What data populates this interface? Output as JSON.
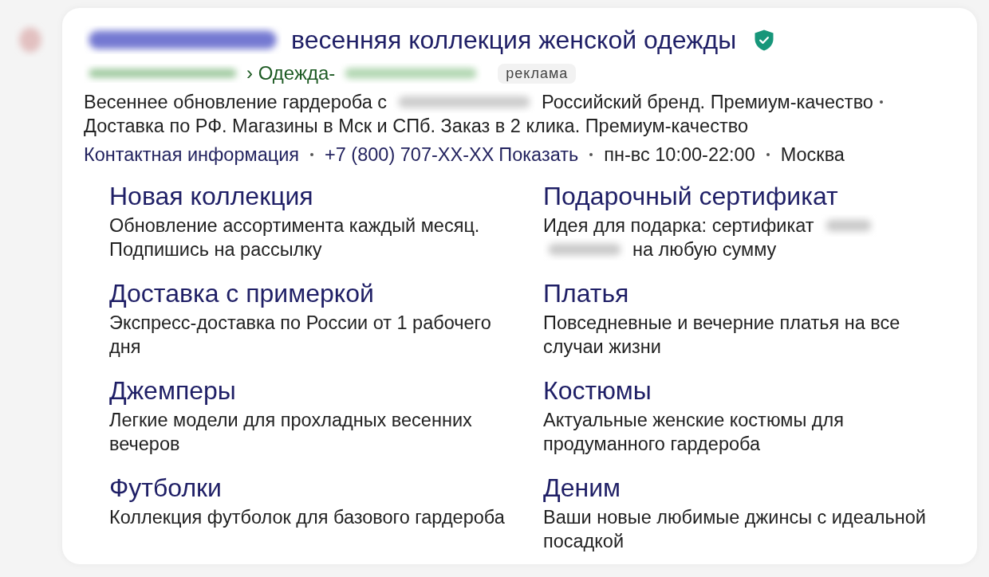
{
  "title": {
    "parts": [
      {
        "kind": "blurred"
      },
      {
        "kind": "text",
        "text": "весенняя коллекция женской одежды"
      }
    ],
    "verified": true
  },
  "url": {
    "parts": [
      {
        "kind": "blurred"
      },
      {
        "kind": "text",
        "text": "› Одежда-"
      },
      {
        "kind": "blurred"
      }
    ],
    "ad_label": "реклама"
  },
  "description": {
    "parts": [
      {
        "kind": "text",
        "text": "Весеннее обновление гардероба с"
      },
      {
        "kind": "blurred"
      },
      {
        "kind": "text",
        "text": "Российский бренд. Премиум-качество"
      }
    ],
    "callouts": "Доставка по РФ. Магазины в Мск и СПб. Заказ в 2 клика. Премиум-качество"
  },
  "contacts": [
    {
      "kind": "link",
      "text": "Контактная информация"
    },
    {
      "kind": "phone",
      "number": "+7 (800) 707-XX-XX",
      "action": "Показать"
    },
    {
      "kind": "plain",
      "text": "пн-вс 10:00-22:00"
    },
    {
      "kind": "plain",
      "text": "Москва"
    }
  ],
  "sitelinks": [
    {
      "title": "Новая коллекция",
      "description": [
        {
          "kind": "text",
          "text": "Обновление ассортимента каждый месяц. Подпишись на рассылку"
        }
      ]
    },
    {
      "title": "Подарочный сертификат",
      "description": [
        {
          "kind": "text",
          "text": "Идея для подарка: сертификат"
        },
        {
          "kind": "blurred"
        },
        {
          "kind": "blurred"
        },
        {
          "kind": "text",
          "text": "на любую сумму"
        }
      ]
    },
    {
      "title": "Доставка с примеркой",
      "description": [
        {
          "kind": "text",
          "text": "Экспресс-доставка по России от 1 рабочего дня"
        }
      ]
    },
    {
      "title": "Платья",
      "description": [
        {
          "kind": "text",
          "text": "Повседневные и вечерние платья на все случаи жизни"
        }
      ]
    },
    {
      "title": "Джемперы",
      "description": [
        {
          "kind": "text",
          "text": "Легкие модели для прохладных весенних вечеров"
        }
      ]
    },
    {
      "title": "Костюмы",
      "description": [
        {
          "kind": "text",
          "text": "Актуальные женские костюмы для продуманного гардероба"
        }
      ]
    },
    {
      "title": "Футболки",
      "description": [
        {
          "kind": "text",
          "text": "Коллекция футболок для базового гардероба"
        }
      ]
    },
    {
      "title": "Деним",
      "description": [
        {
          "kind": "text",
          "text": "Ваши новые любимые джинсы с идеальной посадкой"
        }
      ]
    }
  ]
}
